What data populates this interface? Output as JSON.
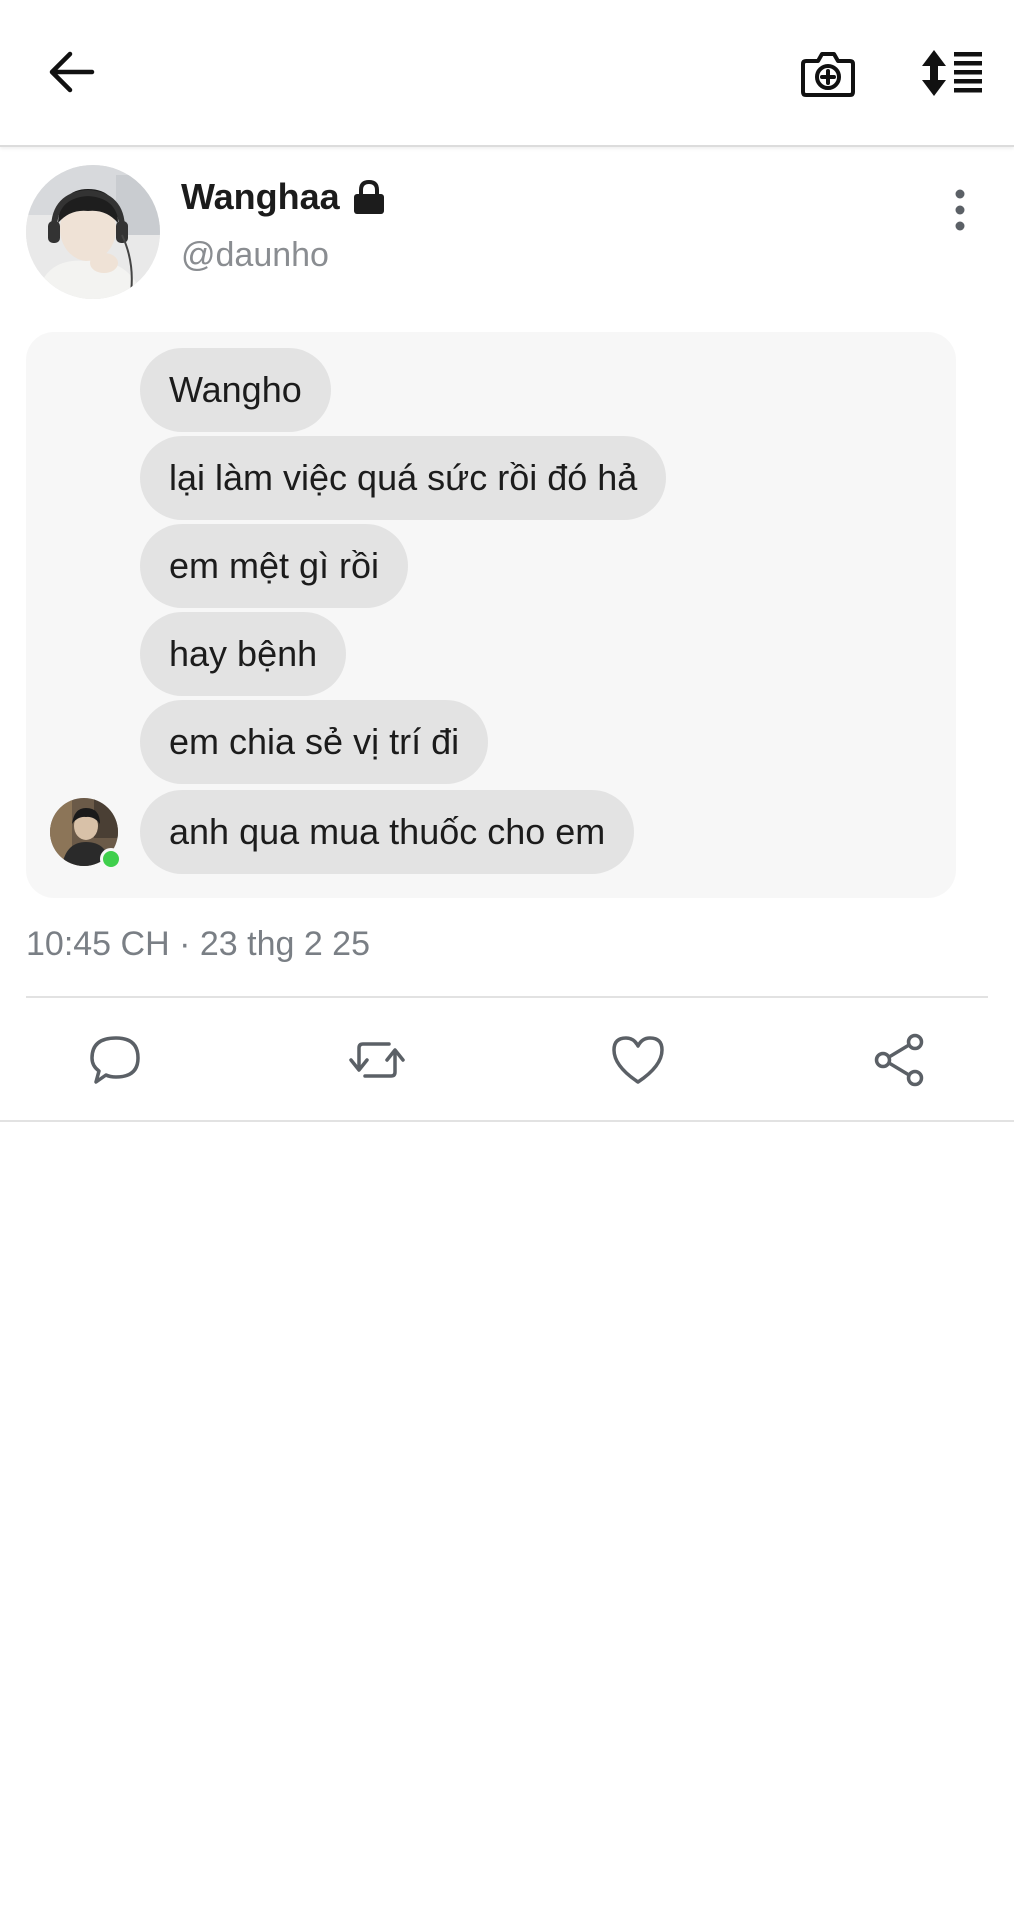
{
  "toolbar": {
    "back_icon": "arrow-left-icon",
    "camera_icon": "camera-plus-icon",
    "sort_icon": "sort-arrows-list-icon"
  },
  "profile": {
    "display_name": "Wanghaa",
    "lock_icon": "lock-icon",
    "username": "@daunho",
    "more_icon": "more-vertical-icon"
  },
  "chat": {
    "messages": [
      "Wangho",
      "lại làm việc quá sức rồi đó hả",
      "em mệt gì rồi",
      "hay bệnh",
      "em chia sẻ vị trí đi",
      "anh qua mua thuốc cho em"
    ],
    "online_color": "#3fcf4c"
  },
  "meta": {
    "timestamp": "10:45 CH · 23 thg 2 25"
  },
  "actions": {
    "reply_icon": "reply-bubble-icon",
    "retweet_icon": "retweet-icon",
    "like_icon": "heart-icon",
    "share_icon": "share-icon"
  }
}
